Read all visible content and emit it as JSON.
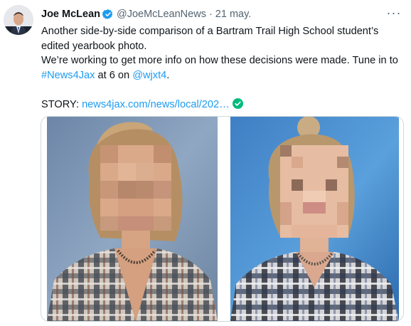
{
  "author": {
    "display_name": "Joe McLean",
    "handle": "@JoeMcLeanNews",
    "separator": "·",
    "date": "21 may.",
    "verified": true
  },
  "menu": {
    "more_label": "···"
  },
  "tweet": {
    "line1": "Another side-by-side comparison of a Bartram Trail High School student’s edited yearbook photo.",
    "line2_a": "We’re working to get more info on how these decisions were made. Tune in to ",
    "hashtag": "#News4Jax",
    "line2_b": " at 6 on ",
    "mention": "@wjxt4",
    "line2_c": ".",
    "story_label": "STORY: ",
    "story_link": "news4jax.com/news/local/202…"
  },
  "media": {
    "image_count": 2
  },
  "colors": {
    "link": "#1d9bf0",
    "verified": "#1d9bf0",
    "secondary_text": "#536471",
    "check": "#00ba7c"
  },
  "icons": [
    "verified-badge-icon",
    "more-options-icon",
    "checkmark-icon"
  ]
}
